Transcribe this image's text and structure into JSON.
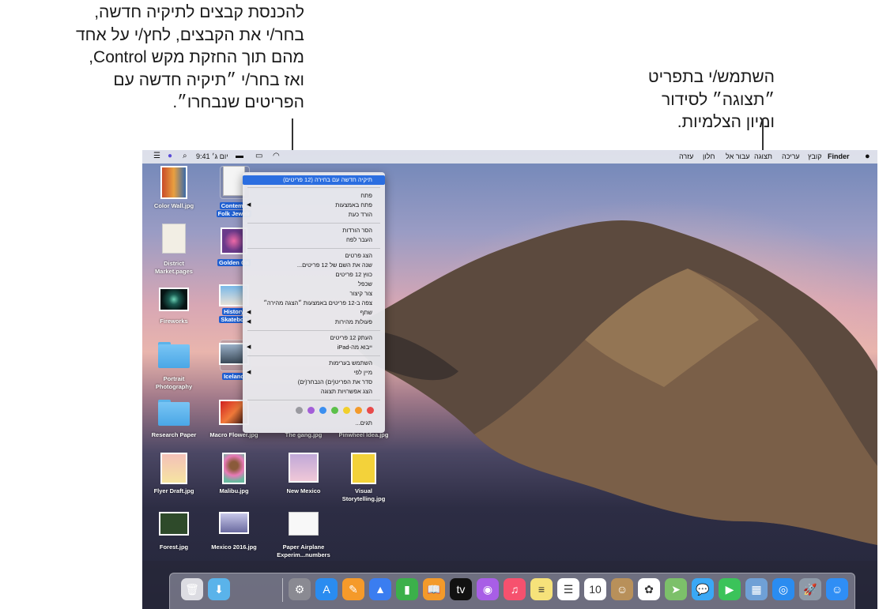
{
  "callouts": {
    "left": [
      "להכנסת קבצים לתיקיה חדשה,",
      "בחר/י את הקבצים, לחץ/י על אחד",
      "מהם תוך החזקת מקש Control,",
      "ואז בחר/י ״תיקיה חדשה עם",
      "הפריטים שנבחרו״."
    ],
    "right": [
      "השתמש/י בתפריט",
      "״תצוגה״ לסידור",
      "ומיון הצלמיות."
    ]
  },
  "menubar": {
    "apple": "",
    "items": [
      "Finder",
      "קובץ",
      "עריכה",
      "תצוגה",
      "עבור אל",
      "חלון",
      "עזרה"
    ],
    "clock": "יום ג׳ 9:41",
    "status_icons": [
      "wifi-icon",
      "airplay-icon",
      "battery-icon",
      "search-icon",
      "siri-icon",
      "control-strip-icon"
    ]
  },
  "desktop": {
    "files": [
      {
        "name": "Color Wall.jpg",
        "type": "image",
        "selected": false
      },
      {
        "name": "Contemporary Folk Jewelry",
        "display": [
          "Contemp",
          "Folk Jewelr"
        ],
        "type": "doc",
        "selected": true
      },
      {
        "name": "District Market.pages",
        "display": [
          "District",
          "Market.pages"
        ],
        "type": "pages",
        "selected": false
      },
      {
        "name": "Golden Gate",
        "display": [
          "Golden Ga"
        ],
        "type": "image",
        "selected": true
      },
      {
        "name": "Fireworks",
        "type": "image",
        "selected": false
      },
      {
        "name": "History Skateboard",
        "display": [
          "History",
          "Skateboa"
        ],
        "type": "image",
        "selected": true
      },
      {
        "name": "Portrait Photography",
        "display": [
          "Portrait",
          "Photography"
        ],
        "type": "folder",
        "selected": false
      },
      {
        "name": "Iceland",
        "display": [
          "Iceland"
        ],
        "type": "image",
        "selected": true
      },
      {
        "name": "Research Paper",
        "type": "folder",
        "selected": false
      },
      {
        "name": "Macro Flower.jpg",
        "type": "image",
        "selected": false
      },
      {
        "name": "The gang.jpg",
        "type": "image",
        "selected": false
      },
      {
        "name": "Pinwheel Idea.jpg",
        "type": "image",
        "selected": false
      },
      {
        "name": "Flyer Draft.jpg",
        "type": "image",
        "selected": false
      },
      {
        "name": "Malibu.jpg",
        "type": "image",
        "selected": false
      },
      {
        "name": "New Mexico",
        "type": "image",
        "selected": false
      },
      {
        "name": "Visual Storytelling.jpg",
        "display": [
          "Visual",
          "Storytelling.jpg"
        ],
        "type": "image",
        "selected": false
      },
      {
        "name": "Forest.jpg",
        "type": "image",
        "selected": false
      },
      {
        "name": "Mexico 2016.jpg",
        "type": "image",
        "selected": false
      },
      {
        "name": "Paper Airplane Experim...numbers",
        "display": [
          "Paper Airplane",
          "Experim...numbers"
        ],
        "type": "numbers",
        "selected": false
      }
    ]
  },
  "context_menu": {
    "items": [
      {
        "label": "תיקיה חדשה עם בחירה (12 פריטים)",
        "highlighted": true
      },
      {
        "label": "פתח"
      },
      {
        "label": "פתח באמצעות",
        "submenu": true
      },
      {
        "label": "הורד כעת"
      },
      {
        "label": "הסר הורדות"
      },
      {
        "label": "העבר לפח"
      },
      {
        "label": "הצג פרטים"
      },
      {
        "label": "שנה את השם של 12 פריטים..."
      },
      {
        "label": "כווץ 12 פריטים"
      },
      {
        "label": "שכפל"
      },
      {
        "label": "צור קיצור"
      },
      {
        "label": "צפה ב-12 פריטים באמצעות ״הצגה מהירה״"
      },
      {
        "label": "שתף",
        "submenu": true
      },
      {
        "label": "פעולות מהירות",
        "submenu": true
      },
      {
        "label": "העתק 12 פריטים"
      },
      {
        "label": "ייבוא מה-iPad",
        "submenu": true
      },
      {
        "label": "השתמש בערימות"
      },
      {
        "label": "מיין לפי",
        "submenu": true
      },
      {
        "label": "סדר את הפריט(ים) הנבחר(ים)"
      },
      {
        "label": "הצג אפשרויות תצוגה"
      },
      {
        "label": "תגים..."
      }
    ],
    "tag_colors": [
      "#e84a4a",
      "#f39a2b",
      "#f1cf2b",
      "#5cc04a",
      "#3b8ff0",
      "#a35ed8",
      "#9a9aa0"
    ]
  },
  "dock": {
    "apps": [
      {
        "name": "finder-icon",
        "color": "#2f8ef5",
        "glyph": "☺"
      },
      {
        "name": "launchpad-icon",
        "color": "#8e9aa8",
        "glyph": "🚀"
      },
      {
        "name": "safari-icon",
        "color": "#2a8cf0",
        "glyph": "◎"
      },
      {
        "name": "preview-icon",
        "color": "#6fa0d6",
        "glyph": "▦"
      },
      {
        "name": "facetime-icon",
        "color": "#3bc35a",
        "glyph": "▶"
      },
      {
        "name": "messages-icon",
        "color": "#3aa8f5",
        "glyph": "💬"
      },
      {
        "name": "maps-icon",
        "color": "#7cc06a",
        "glyph": "➤"
      },
      {
        "name": "photos-icon",
        "color": "#ffffff",
        "glyph": "✿"
      },
      {
        "name": "contacts-icon",
        "color": "#b8905a",
        "glyph": "☺"
      },
      {
        "name": "calendar-icon",
        "color": "#ffffff",
        "glyph": "10"
      },
      {
        "name": "reminders-icon",
        "color": "#ffffff",
        "glyph": "☰"
      },
      {
        "name": "notes-icon",
        "color": "#f6e27a",
        "glyph": "≡"
      },
      {
        "name": "music-icon",
        "color": "#f6516e",
        "glyph": "♫"
      },
      {
        "name": "podcasts-icon",
        "color": "#a85ee6",
        "glyph": "◉"
      },
      {
        "name": "tv-icon",
        "color": "#111111",
        "glyph": "tv"
      },
      {
        "name": "books-icon",
        "color": "#f39a2b",
        "glyph": "📖"
      },
      {
        "name": "numbers-icon",
        "color": "#3bb04a",
        "glyph": "▮"
      },
      {
        "name": "keynote-icon",
        "color": "#3a7df0",
        "glyph": "▲"
      },
      {
        "name": "pages-icon",
        "color": "#f59a2a",
        "glyph": "✎"
      },
      {
        "name": "app-store-icon",
        "color": "#2a8cf0",
        "glyph": "A"
      },
      {
        "name": "system-preferences-icon",
        "color": "#8a8a92",
        "glyph": "⚙"
      }
    ],
    "right": [
      {
        "name": "downloads-folder-icon",
        "color": "#5ab3ea",
        "glyph": "⬇"
      },
      {
        "name": "trash-icon",
        "color": "#dcdce2",
        "glyph": "🗑"
      }
    ]
  },
  "colors": {
    "selection": "#1f5fd1",
    "highlight": "#2b6ee0"
  }
}
